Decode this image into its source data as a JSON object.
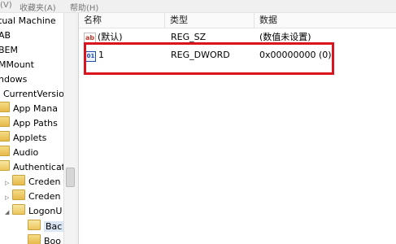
{
  "menubar": {
    "items": [
      "(V)",
      "收藏夹(A)",
      "帮助(H)"
    ]
  },
  "tree": {
    "items": [
      {
        "label": "tual Machine"
      },
      {
        "label": "AB"
      },
      {
        "label": "BEM"
      },
      {
        "label": "MMount"
      },
      {
        "label": "ndows"
      },
      {
        "label": "CurrentVersio"
      },
      {
        "label": "App Mana"
      },
      {
        "label": "App Paths"
      },
      {
        "label": "Applets"
      },
      {
        "label": "Audio"
      },
      {
        "label": "Authenticat"
      },
      {
        "label": "Creden"
      },
      {
        "label": "Creden"
      },
      {
        "label": "LogonU"
      },
      {
        "label": "Bac"
      },
      {
        "label": "Boo"
      }
    ]
  },
  "list": {
    "columns": [
      "名称",
      "类型",
      "数据"
    ],
    "rows": [
      {
        "icon": "string-value-icon",
        "name": "(默认)",
        "type": "REG_SZ",
        "data": "(数值未设置)"
      },
      {
        "icon": "dword-value-icon",
        "name": "1",
        "type": "REG_DWORD",
        "data": "0x00000000 (0)"
      }
    ]
  },
  "colors": {
    "highlight": "#d9141c",
    "selection": "#dbe6f5"
  }
}
